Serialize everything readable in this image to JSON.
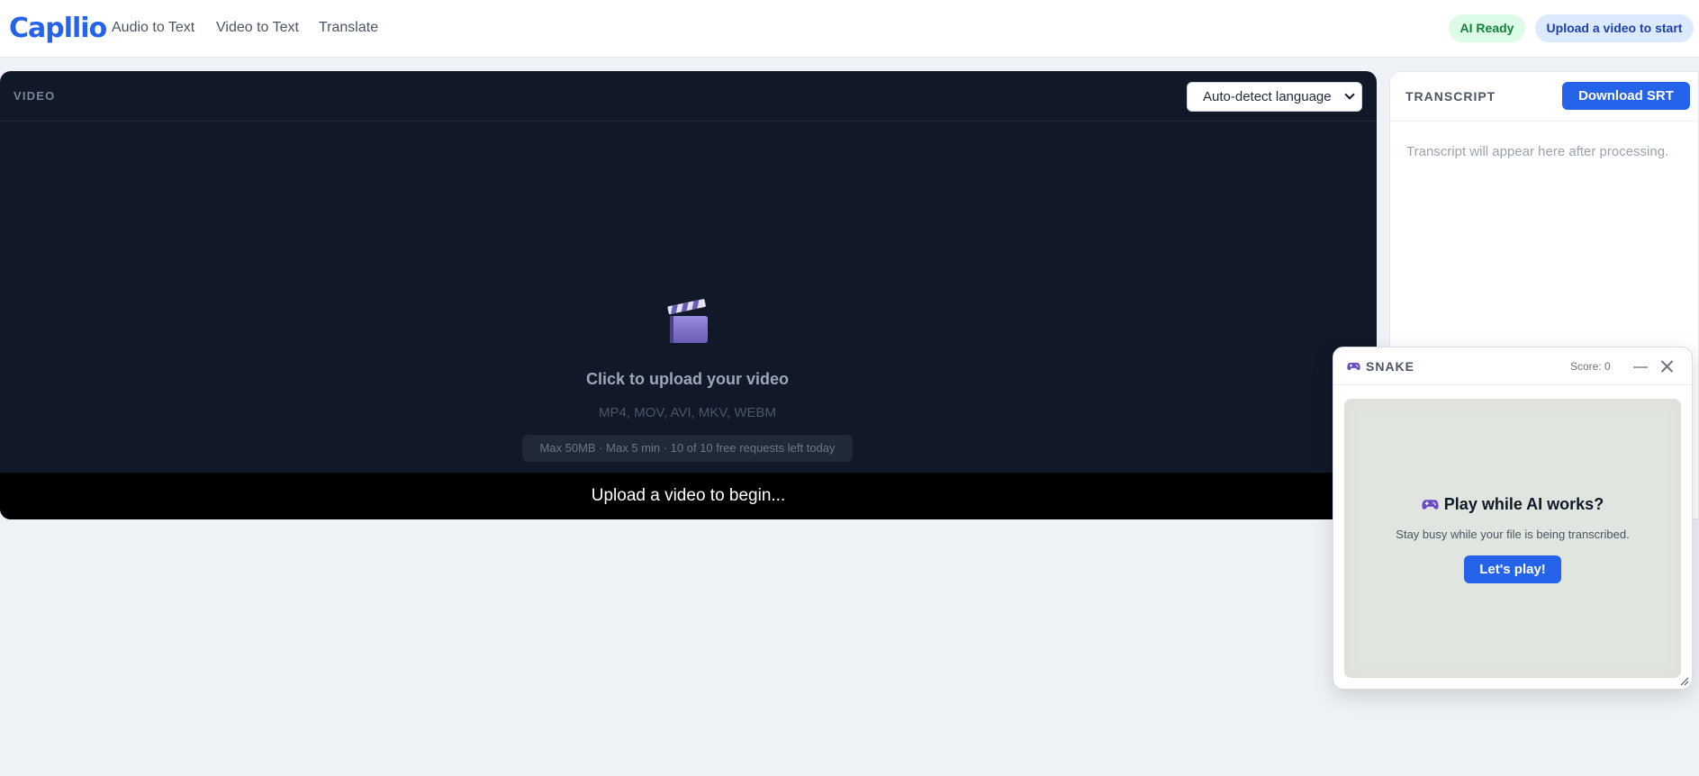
{
  "header": {
    "logo": "Capllio",
    "nav": [
      {
        "label": "Audio to Text"
      },
      {
        "label": "Video to Text"
      },
      {
        "label": "Translate"
      }
    ],
    "status_pill": "AI Ready",
    "cta_pill": "Upload a video to start"
  },
  "video_panel": {
    "label": "VIDEO",
    "language_select": {
      "value": "Auto-detect language"
    },
    "upload": {
      "title": "Click to upload your video",
      "formats": "MP4, MOV, AVI, MKV, WEBM",
      "limits": "Max 50MB · Max 5 min · 10 of 10 free requests left today",
      "icon": "clapperboard-icon"
    },
    "status": "Upload a video to begin..."
  },
  "transcript_panel": {
    "label": "TRANSCRIPT",
    "download_label": "Download SRT",
    "placeholder": "Transcript will appear here after processing."
  },
  "snake_widget": {
    "title": "SNAKE",
    "score": "Score: 0",
    "icon": "gamepad-icon",
    "prompt_title": "Play while AI works?",
    "prompt_subtitle": "Stay busy while your file is being transcribed.",
    "play_label": "Let's play!"
  },
  "colors": {
    "accent": "#2563eb",
    "video_bg": "#111827",
    "page_bg": "#eff3f7",
    "ready_bg": "#dcfce7",
    "ready_text": "#15803d"
  }
}
